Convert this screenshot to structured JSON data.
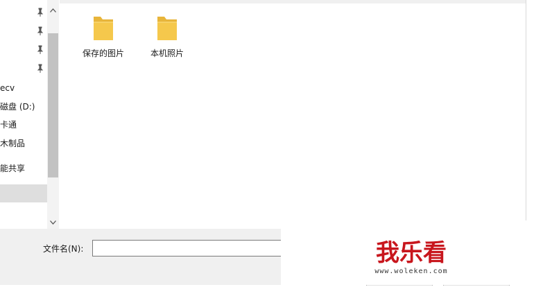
{
  "nav": {
    "items": [
      {
        "label": "",
        "pinned": true
      },
      {
        "label": "",
        "pinned": true
      },
      {
        "label": "",
        "pinned": true
      },
      {
        "label": "",
        "pinned": true
      },
      {
        "label": "ecv",
        "pinned": false
      },
      {
        "label": "磁盘 (D:)",
        "pinned": false
      },
      {
        "label": "卡通",
        "pinned": false
      },
      {
        "label": "木制品",
        "pinned": false
      },
      {
        "label": "能共享",
        "pinned": false
      },
      {
        "label": "",
        "pinned": false,
        "selected": true
      }
    ]
  },
  "folders": [
    {
      "label": "保存的图片"
    },
    {
      "label": "本机照片"
    }
  ],
  "bottom": {
    "filename_label": "文件名(N):",
    "filename_value": ""
  },
  "watermark": {
    "brand": "我乐看",
    "url": "www.woleken.com"
  },
  "colors": {
    "folder": "#f5c84c",
    "folder_dark": "#e8b53a",
    "watermark_red": "#c8161d"
  }
}
